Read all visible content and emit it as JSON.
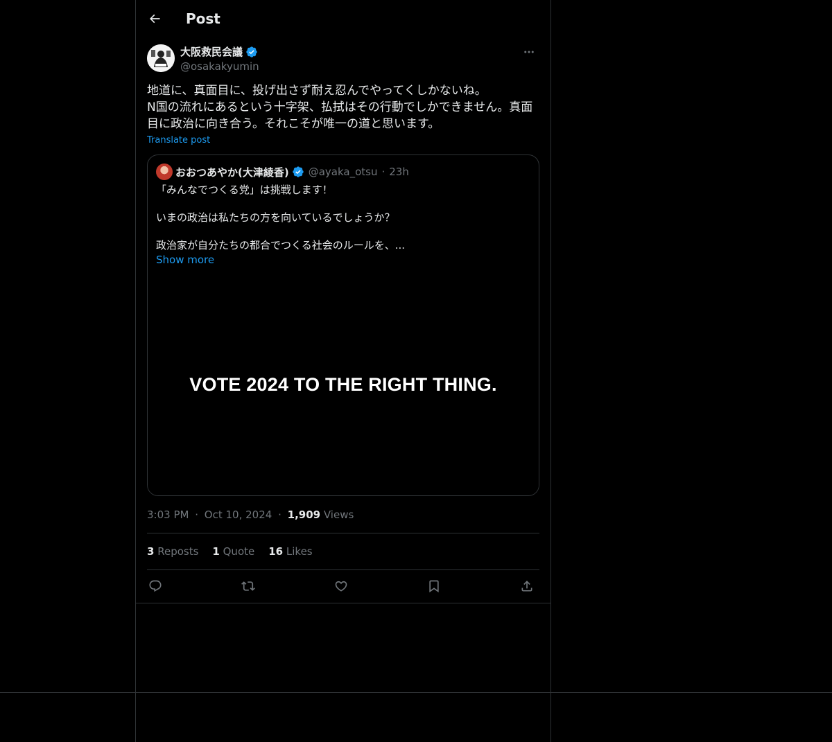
{
  "header": {
    "title": "Post"
  },
  "post": {
    "author": {
      "name": "大阪救民会議",
      "handle": "@osakakyumin",
      "verified_color": "#1d9bf0"
    },
    "text": "地道に、真面目に、投げ出さず耐え忍んでやってくしかないね。\nN国の流れにあるという十字架、払拭はその行動でしかできません。真面目に政治に向き合う。それこそが唯一の道と思います。",
    "translate_label": "Translate post",
    "quote": {
      "name": "おおつあやか(大津綾香)",
      "handle": "@ayaka_otsu",
      "separator": "·",
      "time": "23h",
      "paragraphs": [
        "「みんなでつくる党」は挑戦します！",
        "いまの政治は私たちの方を向いているでしょうか？",
        "政治家が自分たちの都合でつくる社会のルールを、..."
      ],
      "show_more": "Show more",
      "media_text": "VOTE 2024 TO THE RIGHT THING."
    },
    "meta": {
      "time": "3:03 PM",
      "sep": "·",
      "date": "Oct 10, 2024",
      "views_count": "1,909",
      "views_label": "Views"
    },
    "stats": {
      "reposts_count": "3",
      "reposts_label": "Reposts",
      "quotes_count": "1",
      "quotes_label": "Quote",
      "likes_count": "16",
      "likes_label": "Likes"
    }
  },
  "icons": {
    "back": "back-arrow-icon",
    "more": "more-dots-icon",
    "verified": "verified-badge-icon",
    "reply": "reply-icon",
    "repost": "repost-icon",
    "like": "heart-icon",
    "bookmark": "bookmark-icon",
    "share": "share-icon"
  },
  "colors": {
    "background": "#000000",
    "text": "#e7e9ea",
    "muted": "#71767b",
    "accent": "#1d9bf0",
    "border": "#2f3336"
  }
}
